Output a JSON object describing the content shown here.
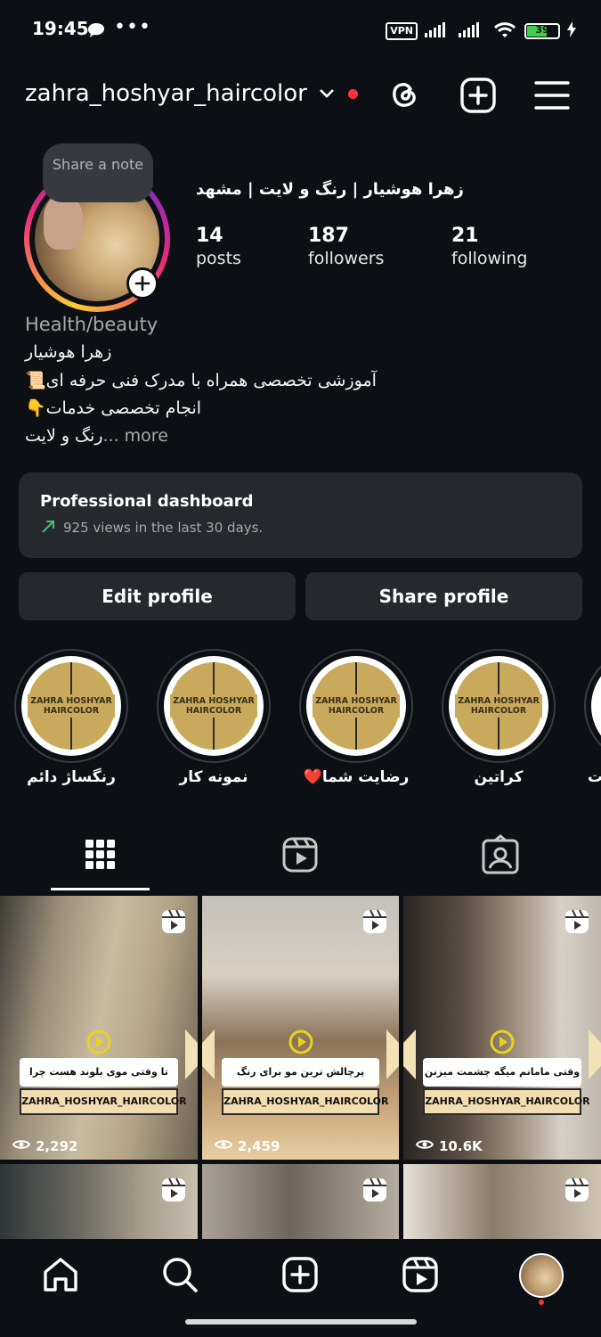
{
  "status_bar": {
    "time": "19:45",
    "dots": "•••",
    "vpn": "VPN",
    "battery": "39"
  },
  "header": {
    "username": "zahra_hoshyar_haircolor"
  },
  "note": {
    "label": "Share a note"
  },
  "profile": {
    "name": "زهرا هوشیار | رنگ و لایت | مشهد",
    "stats": [
      {
        "count": "14",
        "label": "posts"
      },
      {
        "count": "187",
        "label": "followers"
      },
      {
        "count": "21",
        "label": "following"
      }
    ],
    "category": "Health/beauty",
    "bio": [
      "زهرا هوشیار",
      "📜آموزشی تخصصی همراه با مدرک فنی حرفه ای",
      "👇انجام تخصصی خدمات",
      "رنگ و لایت"
    ],
    "bio_more": "... more"
  },
  "dashboard": {
    "title": "Professional dashboard",
    "subtitle": "925 views in the last 30 days."
  },
  "buttons": {
    "edit": "Edit profile",
    "share": "Share profile"
  },
  "highlights": [
    {
      "brand": "ZAHRA HOSHYAR HAIRCOLOR",
      "label": "رنگساژ دائم"
    },
    {
      "brand": "ZAHRA HOSHYAR HAIRCOLOR",
      "label": "نمونه کار"
    },
    {
      "brand": "ZAHRA HOSHYAR HAIRCOLOR",
      "label": "رضایت شما❤️"
    },
    {
      "brand": "ZAHRA HOSHYAR HAIRCOLOR",
      "label": "کراتین"
    },
    {
      "brand": "",
      "label": "ت"
    }
  ],
  "posts": [
    {
      "caption": "تا وقتی موی بلوند هست چرا مشکی آخه؟!",
      "tag": "ZAHRA_HOSHYAR_HAIRCOLOR",
      "views": "2,292"
    },
    {
      "caption": "پرچالش ترین مو برای رنگ",
      "tag": "ZAHRA_HOSHYAR_HAIRCOLOR",
      "views": "2,459"
    },
    {
      "caption": "وقتی مامانم میگه چشمت میزنن",
      "tag": "ZAHRA_HOSHYAR_HAIRCOLOR",
      "views": "10.6K"
    }
  ],
  "colors": {
    "background": "#0c1014",
    "card": "#25292e",
    "accent_red": "#ff3040",
    "trend_green": "#3fc16a"
  }
}
